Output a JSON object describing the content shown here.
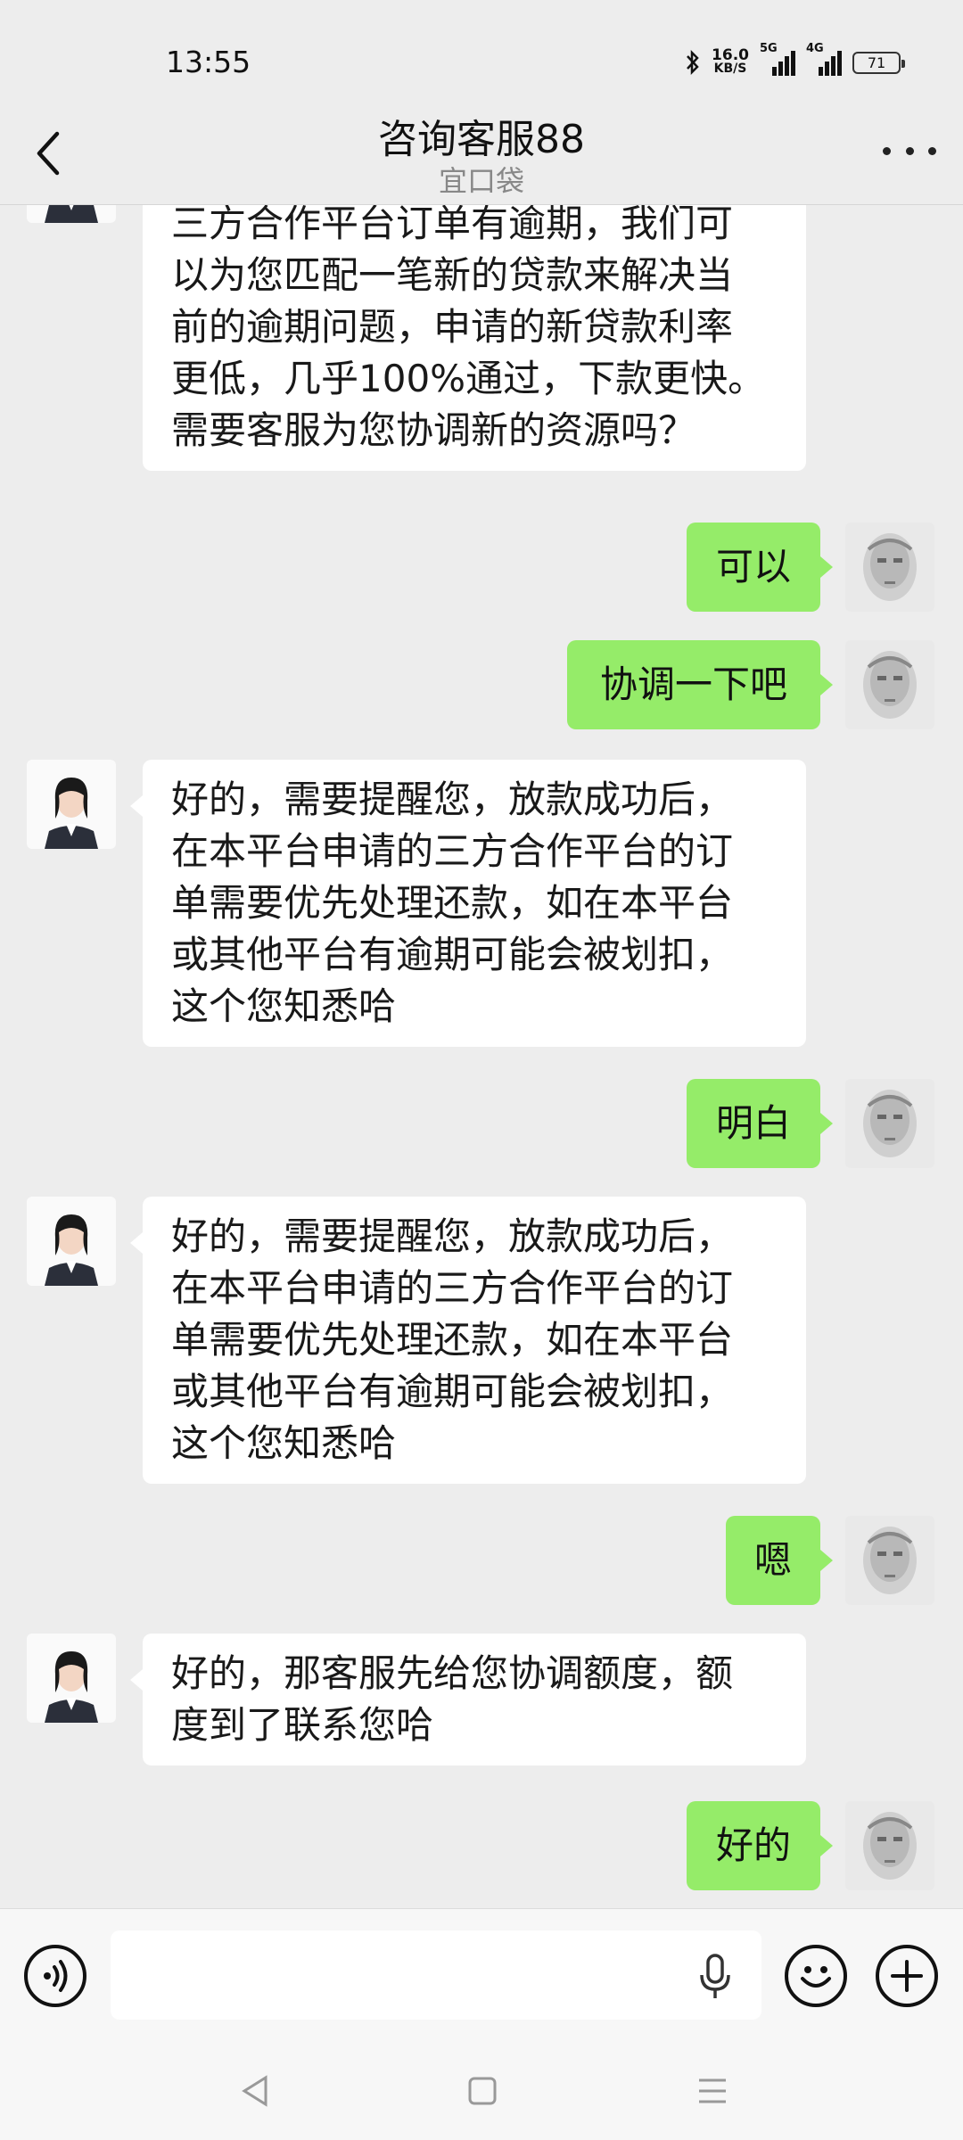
{
  "status_bar": {
    "time": "13:55",
    "net_speed": "16.0",
    "net_unit": "KB/S",
    "sig1_label": "5G",
    "sig2_label": "4G",
    "battery": "71"
  },
  "header": {
    "title": "咨询客服88",
    "subtitle": "宜口袋"
  },
  "messages": [
    {
      "side": "left",
      "text": "您好，关注到您在宜口袋上申请的\n三方合作平台订单有逾期，我们可\n以为您匹配一笔新的贷款来解决当\n前的逾期问题，申请的新贷款利率\n更低，几乎100%通过，下款更快。\n需要客服为您协调新的资源吗？"
    },
    {
      "side": "right",
      "text": "可以"
    },
    {
      "side": "right",
      "text": "协调一下吧"
    },
    {
      "side": "left",
      "text": "好的，需要提醒您，放款成功后，\n在本平台申请的三方合作平台的订\n单需要优先处理还款，如在本平台\n或其他平台有逾期可能会被划扣，\n这个您知悉哈"
    },
    {
      "side": "right",
      "text": "明白"
    },
    {
      "side": "left",
      "text": "好的，需要提醒您，放款成功后，\n在本平台申请的三方合作平台的订\n单需要优先处理还款，如在本平台\n或其他平台有逾期可能会被划扣，\n这个您知悉哈"
    },
    {
      "side": "right",
      "text": "嗯"
    },
    {
      "side": "left",
      "text": "好的，那客服先给您协调额度，额\n度到了联系您哈"
    },
    {
      "side": "right",
      "text": "好的"
    }
  ],
  "input": {
    "value": "",
    "placeholder": ""
  },
  "icons": {
    "voice": "voice-icon",
    "mic": "mic-icon",
    "emoji": "emoji-icon",
    "plus": "plus-icon",
    "back": "back-icon",
    "more": "more-icon",
    "nav_back": "nav-back-icon",
    "nav_home": "nav-home-icon",
    "nav_recent": "nav-recent-icon"
  },
  "colors": {
    "background": "#ededed",
    "bubble_self": "#95ec69",
    "bubble_other": "#ffffff"
  }
}
